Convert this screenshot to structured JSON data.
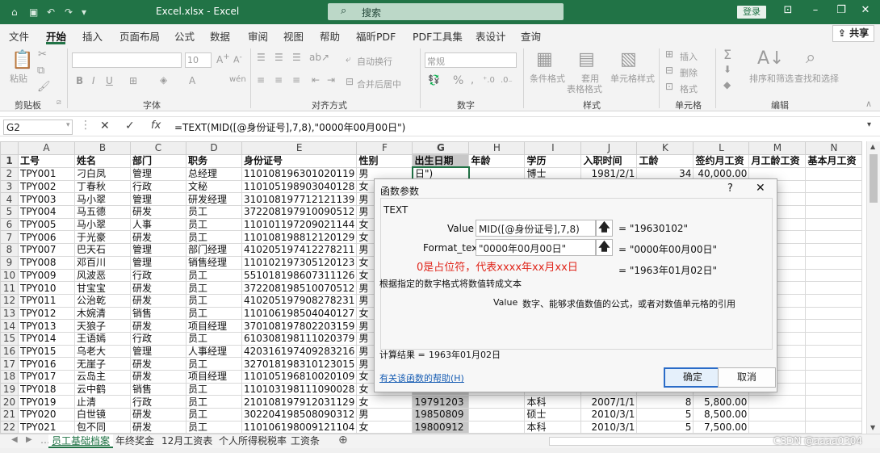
{
  "titlebar": {
    "filename": "Excel.xlsx",
    "separator": "-",
    "app": "Excel",
    "search_placeholder": "搜索",
    "login": "登录"
  },
  "menu": {
    "tabs": [
      "文件",
      "开始",
      "插入",
      "页面布局",
      "公式",
      "数据",
      "审阅",
      "视图",
      "帮助",
      "福昕PDF",
      "PDF工具集",
      "表设计",
      "查询"
    ],
    "active_index": 1,
    "share": "共享"
  },
  "ribbon": {
    "paste": "粘贴",
    "groups": [
      "剪贴板",
      "字体",
      "对齐方式",
      "数字",
      "样式",
      "单元格",
      "编辑"
    ],
    "font_size": "10",
    "wrap_text": "自动换行",
    "merge_center": "合并后居中",
    "number_format": "常规",
    "cond_format": "条件格式",
    "table_format_1": "套用",
    "table_format_2": "表格格式",
    "cell_style": "单元格样式",
    "insert": "插入",
    "delete": "删除",
    "format": "格式",
    "sort_filter": "排序和筛选",
    "find_select": "查找和选择"
  },
  "formula_bar": {
    "name_box": "G2",
    "formula": "=TEXT(MID([@身份证号],7,8),\"0000年00月00日\")"
  },
  "grid": {
    "columns": [
      "A",
      "B",
      "C",
      "D",
      "E",
      "F",
      "G",
      "H",
      "I",
      "J",
      "K",
      "L",
      "M",
      "N"
    ],
    "header": [
      "工号",
      "姓名",
      "部门",
      "职务",
      "身份证号",
      "性别",
      "出生日期",
      "年龄",
      "学历",
      "入职时间",
      "工龄",
      "签约月工资",
      "月工龄工资",
      "基本月工资"
    ],
    "rows": [
      [
        "TPY001",
        "刁白凤",
        "管理",
        "总经理",
        "110108196301020119",
        "男",
        "日\")",
        "",
        "博士",
        "1981/2/1",
        "34",
        "40,000.00",
        "",
        ""
      ],
      [
        "TPY002",
        "丁春秋",
        "行政",
        "文秘",
        "110105198903040128",
        "女",
        "",
        "",
        "",
        "",
        "",
        "",
        "",
        ""
      ],
      [
        "TPY003",
        "马小翠",
        "管理",
        "研发经理",
        "310108197712121139",
        "男",
        "",
        "",
        "",
        "",
        "",
        "",
        "",
        ""
      ],
      [
        "TPY004",
        "马五德",
        "研发",
        "员工",
        "372208197910090512",
        "男",
        "",
        "",
        "",
        "",
        "",
        "",
        "",
        ""
      ],
      [
        "TPY005",
        "马小翠",
        "人事",
        "员工",
        "110101197209021144",
        "女",
        "",
        "",
        "",
        "",
        "",
        "",
        "",
        ""
      ],
      [
        "TPY006",
        "于光豪",
        "研发",
        "员工",
        "110108198812120129",
        "女",
        "",
        "",
        "",
        "",
        "",
        "",
        "",
        ""
      ],
      [
        "TPY007",
        "巴天石",
        "管理",
        "部门经理",
        "410205197412278211",
        "男",
        "",
        "",
        "",
        "",
        "",
        "",
        "",
        ""
      ],
      [
        "TPY008",
        "邓百川",
        "管理",
        "销售经理",
        "110102197305120123",
        "女",
        "",
        "",
        "",
        "",
        "",
        "",
        "",
        ""
      ],
      [
        "TPY009",
        "风波恶",
        "行政",
        "员工",
        "551018198607311126",
        "女",
        "",
        "",
        "",
        "",
        "",
        "",
        "",
        ""
      ],
      [
        "TPY010",
        "甘宝宝",
        "研发",
        "员工",
        "372208198510070512",
        "男",
        "",
        "",
        "",
        "",
        "",
        "",
        "",
        ""
      ],
      [
        "TPY011",
        "公治乾",
        "研发",
        "员工",
        "410205197908278231",
        "男",
        "",
        "",
        "",
        "",
        "",
        "",
        "",
        ""
      ],
      [
        "TPY012",
        "木婉清",
        "销售",
        "员工",
        "110106198504040127",
        "女",
        "",
        "",
        "",
        "",
        "",
        "",
        "",
        ""
      ],
      [
        "TPY013",
        "天狼子",
        "研发",
        "项目经理",
        "370108197802203159",
        "男",
        "",
        "",
        "",
        "",
        "",
        "",
        "",
        ""
      ],
      [
        "TPY014",
        "王语嫣",
        "行政",
        "员工",
        "610308198111020379",
        "男",
        "",
        "",
        "",
        "",
        "",
        "",
        "",
        ""
      ],
      [
        "TPY015",
        "乌老大",
        "管理",
        "人事经理",
        "420316197409283216",
        "男",
        "",
        "",
        "",
        "",
        "",
        "",
        "",
        ""
      ],
      [
        "TPY016",
        "无崖子",
        "研发",
        "员工",
        "327018198310123015",
        "男",
        "",
        "",
        "",
        "",
        "",
        "",
        "",
        ""
      ],
      [
        "TPY017",
        "云岛主",
        "研发",
        "项目经理",
        "110105196810020109",
        "女",
        "",
        "",
        "",
        "",
        "",
        "",
        "",
        ""
      ],
      [
        "TPY018",
        "云中鹤",
        "销售",
        "员工",
        "110103198111090028",
        "女",
        "",
        "",
        "",
        "",
        "",
        "",
        "",
        ""
      ],
      [
        "TPY019",
        "止清",
        "行政",
        "员工",
        "210108197912031129",
        "女",
        "19791203",
        "",
        "本科",
        "2007/1/1",
        "8",
        "5,800.00",
        "",
        ""
      ],
      [
        "TPY020",
        "白世镜",
        "研发",
        "员工",
        "302204198508090312",
        "男",
        "19850809",
        "",
        "硕士",
        "2010/3/1",
        "5",
        "8,500.00",
        "",
        ""
      ],
      [
        "TPY021",
        "包不同",
        "研发",
        "员工",
        "110106198009121104",
        "女",
        "19800912",
        "",
        "本科",
        "2010/3/1",
        "5",
        "7,500.00",
        "",
        ""
      ]
    ]
  },
  "sheet_tabs": [
    "员工基础档案",
    "年终奖金",
    "12月工资表",
    "个人所得税税率",
    "工资条"
  ],
  "active_sheet": 0,
  "dialog": {
    "title": "函数参数",
    "help": "?",
    "func": "TEXT",
    "arg1_label": "Value",
    "arg1_value": "MID([@身份证号],7,8)",
    "arg1_result": "= \"19630102\"",
    "arg2_label": "Format_text",
    "arg2_value": "\"0000年00月00日\"",
    "arg2_result": "= \"0000年00月00日\"",
    "annotation": "0是占位符，代表xxxx年xx月xx日",
    "overall_result": "= \"1963年01月02日\"",
    "description": "根据指定的数字格式将数值转成文本",
    "arg_help_name": "Value",
    "arg_help_text": "数字、能够求值数值的公式，或者对数值单元格的引用",
    "calc_label": "计算结果 =",
    "calc_value": "1963年01月02日",
    "help_link": "有关该函数的帮助(H)",
    "ok": "确定",
    "cancel": "取消"
  },
  "watermark": "CSDN @aaaa0304",
  "colors": {
    "excel_green": "#217346",
    "annotation_red": "#e0261b",
    "link_blue": "#1a5fb4"
  }
}
